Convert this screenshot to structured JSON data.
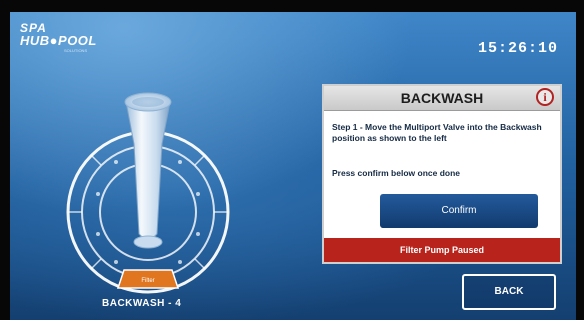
{
  "logo": {
    "line1": "SPA",
    "line2": "HUB●POOL",
    "tagline": "SOLUTIONS"
  },
  "clock": "15:26:10",
  "valve": {
    "label": "BACKWASH - 4",
    "selected_position": "Filter",
    "colors": {
      "accent": "#e0761f",
      "body": "#dfeaf5",
      "ring": "#ffffff"
    }
  },
  "panel": {
    "title": "BACKWASH",
    "info_icon": "info-icon",
    "info_glyph": "i",
    "step_text": "Step 1 - Move the Multiport Valve into the Backwash position as shown to the left",
    "confirm_instruction": "Press confirm below once done",
    "confirm_label": "Confirm",
    "status": "Filter Pump Paused"
  },
  "back_label": "BACK",
  "colors": {
    "status_bar": "#b8231c",
    "confirm_button": "#1b4a85",
    "screen": "#2f6fae"
  }
}
